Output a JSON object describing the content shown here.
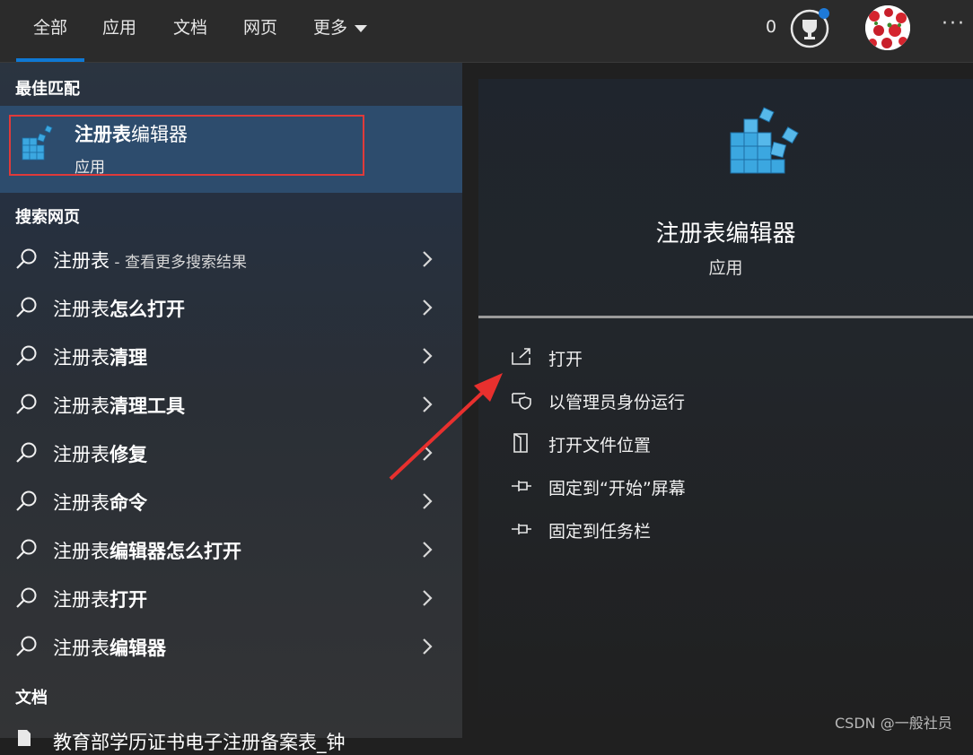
{
  "tabs": {
    "all": "全部",
    "apps": "应用",
    "docs": "文档",
    "web": "网页",
    "more": "更多"
  },
  "header": {
    "points": "0",
    "reward_icon": "trophy-icon",
    "avatar": "strawberry-avatar",
    "more_label": "···"
  },
  "sections": {
    "best_match": "最佳匹配",
    "search_web": "搜索网页",
    "documents": "文档"
  },
  "best_match": {
    "title_bold": "注册表",
    "title_rest": "编辑器",
    "subtitle": "应用"
  },
  "web_results": [
    {
      "prefix": "注册表",
      "bold": "",
      "hint": " - 查看更多搜索结果"
    },
    {
      "prefix": "注册表",
      "bold": "怎么打开",
      "hint": ""
    },
    {
      "prefix": "注册表",
      "bold": "清理",
      "hint": ""
    },
    {
      "prefix": "注册表",
      "bold": "清理工具",
      "hint": ""
    },
    {
      "prefix": "注册表",
      "bold": "修复",
      "hint": ""
    },
    {
      "prefix": "注册表",
      "bold": "命令",
      "hint": ""
    },
    {
      "prefix": "注册表",
      "bold": "编辑器怎么打开",
      "hint": ""
    },
    {
      "prefix": "注册表",
      "bold": "打开",
      "hint": ""
    },
    {
      "prefix": "注册表",
      "bold": "编辑器",
      "hint": ""
    }
  ],
  "documents": [
    {
      "label": "教育部学历证书电子注册备案表_钟"
    }
  ],
  "detail": {
    "title": "注册表编辑器",
    "subtitle": "应用",
    "actions": [
      {
        "label": "打开",
        "icon": "open-icon"
      },
      {
        "label": "以管理员身份运行",
        "icon": "shield-icon"
      },
      {
        "label": "打开文件位置",
        "icon": "file-location-icon"
      },
      {
        "label": "固定到“开始”屏幕",
        "icon": "pin-icon"
      },
      {
        "label": "固定到任务栏",
        "icon": "pin-icon"
      }
    ]
  },
  "watermark": "CSDN @一般社员",
  "colors": {
    "accent": "#0f78d4",
    "highlight": "#e03a3a",
    "selected_bg": "#2d4c6d"
  }
}
